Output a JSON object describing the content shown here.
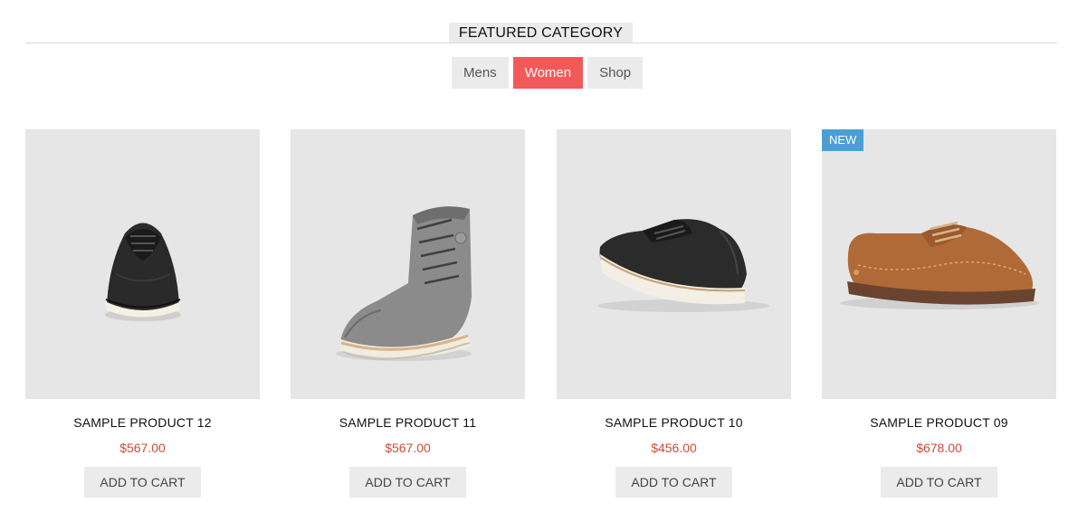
{
  "section": {
    "title": "FEATURED CATEGORY"
  },
  "tabs": [
    {
      "label": "Mens",
      "active": false
    },
    {
      "label": "Women",
      "active": true
    },
    {
      "label": "Shop",
      "active": false
    }
  ],
  "products": [
    {
      "name": "SAMPLE PRODUCT 12",
      "price": "$567.00",
      "cta": "ADD TO CART",
      "badge": ""
    },
    {
      "name": "SAMPLE PRODUCT 11",
      "price": "$567.00",
      "cta": "ADD TO CART",
      "badge": ""
    },
    {
      "name": "SAMPLE PRODUCT 10",
      "price": "$456.00",
      "cta": "ADD TO CART",
      "badge": ""
    },
    {
      "name": "SAMPLE PRODUCT 09",
      "price": "$678.00",
      "cta": "ADD TO CART",
      "badge": "NEW"
    }
  ],
  "colors": {
    "accent": "#f25a5a",
    "price": "#cf4b3a",
    "badge": "#4b9fd5",
    "tab_bg": "#ebebeb"
  }
}
